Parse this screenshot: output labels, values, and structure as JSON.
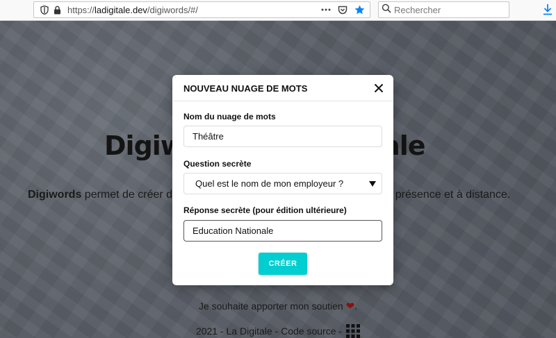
{
  "browser": {
    "url_scheme": "https://",
    "url_host": "ladigitale.dev",
    "url_path": "/digiwords/#/",
    "search_placeholder": "Rechercher"
  },
  "page": {
    "title_start": "Digiw",
    "title_end": "tale",
    "desc_bold": "Digiwords",
    "desc_start": " permet de créer d",
    "desc_end": "s en présence et à distance.",
    "support_text": "Je souhaite apporter mon soutien",
    "footer_text": "2021 - La Digitale - Code source -"
  },
  "modal": {
    "title": "NOUVEAU NUAGE DE MOTS",
    "name_label": "Nom du nuage de mots",
    "name_value": "Théâtre",
    "question_label": "Question secrète",
    "question_value": "Quel est le nom de mon employeur ?",
    "answer_label": "Réponse secrète (pour édition ultérieure)",
    "answer_value": "Education Nationale",
    "create_label": "CRÉER"
  },
  "colors": {
    "accent": "#00ced1",
    "heart": "#8b1010",
    "download": "#0a84ff",
    "bookmark_star": "#0a84ff"
  }
}
